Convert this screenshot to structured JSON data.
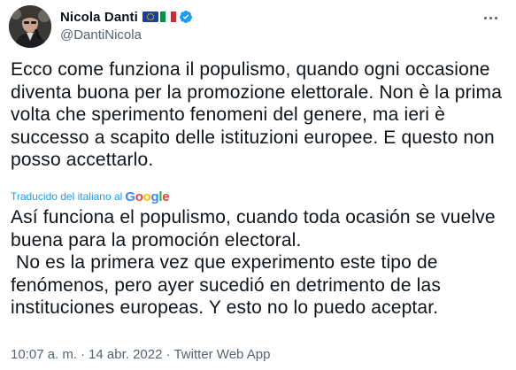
{
  "author": {
    "display_name": "Nicola Danti",
    "handle": "@DantiNicola",
    "verified": true,
    "flags": [
      "eu-flag-icon",
      "italy-flag-icon"
    ]
  },
  "tweet": {
    "text": "Ecco come funziona il populismo, quando ogni occasione diventa buona per la promozione elettorale. Non è la prima volta che sperimento fenomeni del genere, ma ieri è successo a scapito delle istituzioni europee. E questo non posso accettarlo.",
    "translated_by_label": "Traducido del italiano al",
    "translation_provider": "Google",
    "translation": "Así funciona el populismo, cuando toda ocasión se vuelve buena para la promoción electoral.\n No es la primera vez que experimento este tipo de fenómenos, pero ayer sucedió en detrimento de las instituciones europeas. Y esto no lo puedo aceptar."
  },
  "meta": {
    "time": "10:07 a. m.",
    "separator": "·",
    "date": "14 abr. 2022",
    "source": "Twitter Web App"
  },
  "colors": {
    "text": "#0f1419",
    "secondary": "#536471",
    "accent": "#1d9bf0"
  }
}
